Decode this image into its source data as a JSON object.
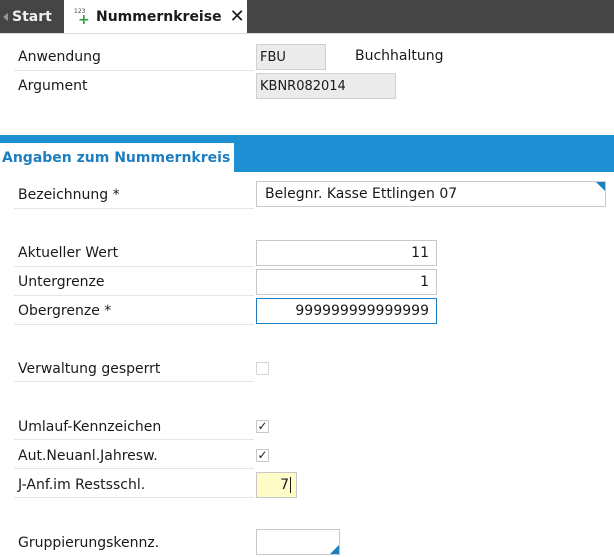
{
  "tabs": {
    "start_label": "Start",
    "active_label": "Nummernkreise",
    "active_icon_num": "123",
    "active_icon_plus": "+",
    "close_glyph": "✕"
  },
  "header": {
    "anwendung_label": "Anwendung",
    "anwendung_value": "FBU",
    "anwendung_text": "Buchhaltung",
    "argument_label": "Argument",
    "argument_value": "KBNR082014"
  },
  "section": {
    "title": "Angaben zum Nummernkreis"
  },
  "form": {
    "bezeichnung_label": "Bezeichnung *",
    "bezeichnung_value": "Belegnr. Kasse Ettlingen 07",
    "aktueller_wert_label": "Aktueller Wert",
    "aktueller_wert_value": "11",
    "untergrenze_label": "Untergrenze",
    "untergrenze_value": "1",
    "obergrenze_label": "Obergrenze *",
    "obergrenze_value": "999999999999999",
    "verwaltung_label": "Verwaltung gesperrt",
    "verwaltung_checked": false,
    "umlauf_label": "Umlauf-Kennzeichen",
    "umlauf_checked": true,
    "neuanl_label": "Aut.Neuanl.Jahresw.",
    "neuanl_checked": true,
    "janf_label": "J-Anf.im Restsschl.",
    "janf_value": "7",
    "gruppierung_label": "Gruppierungskennz.",
    "gruppierung_value": ""
  },
  "colors": {
    "accent": "#1e8fd3",
    "tabbar": "#454545",
    "highlight_field": "#fffcc8"
  }
}
